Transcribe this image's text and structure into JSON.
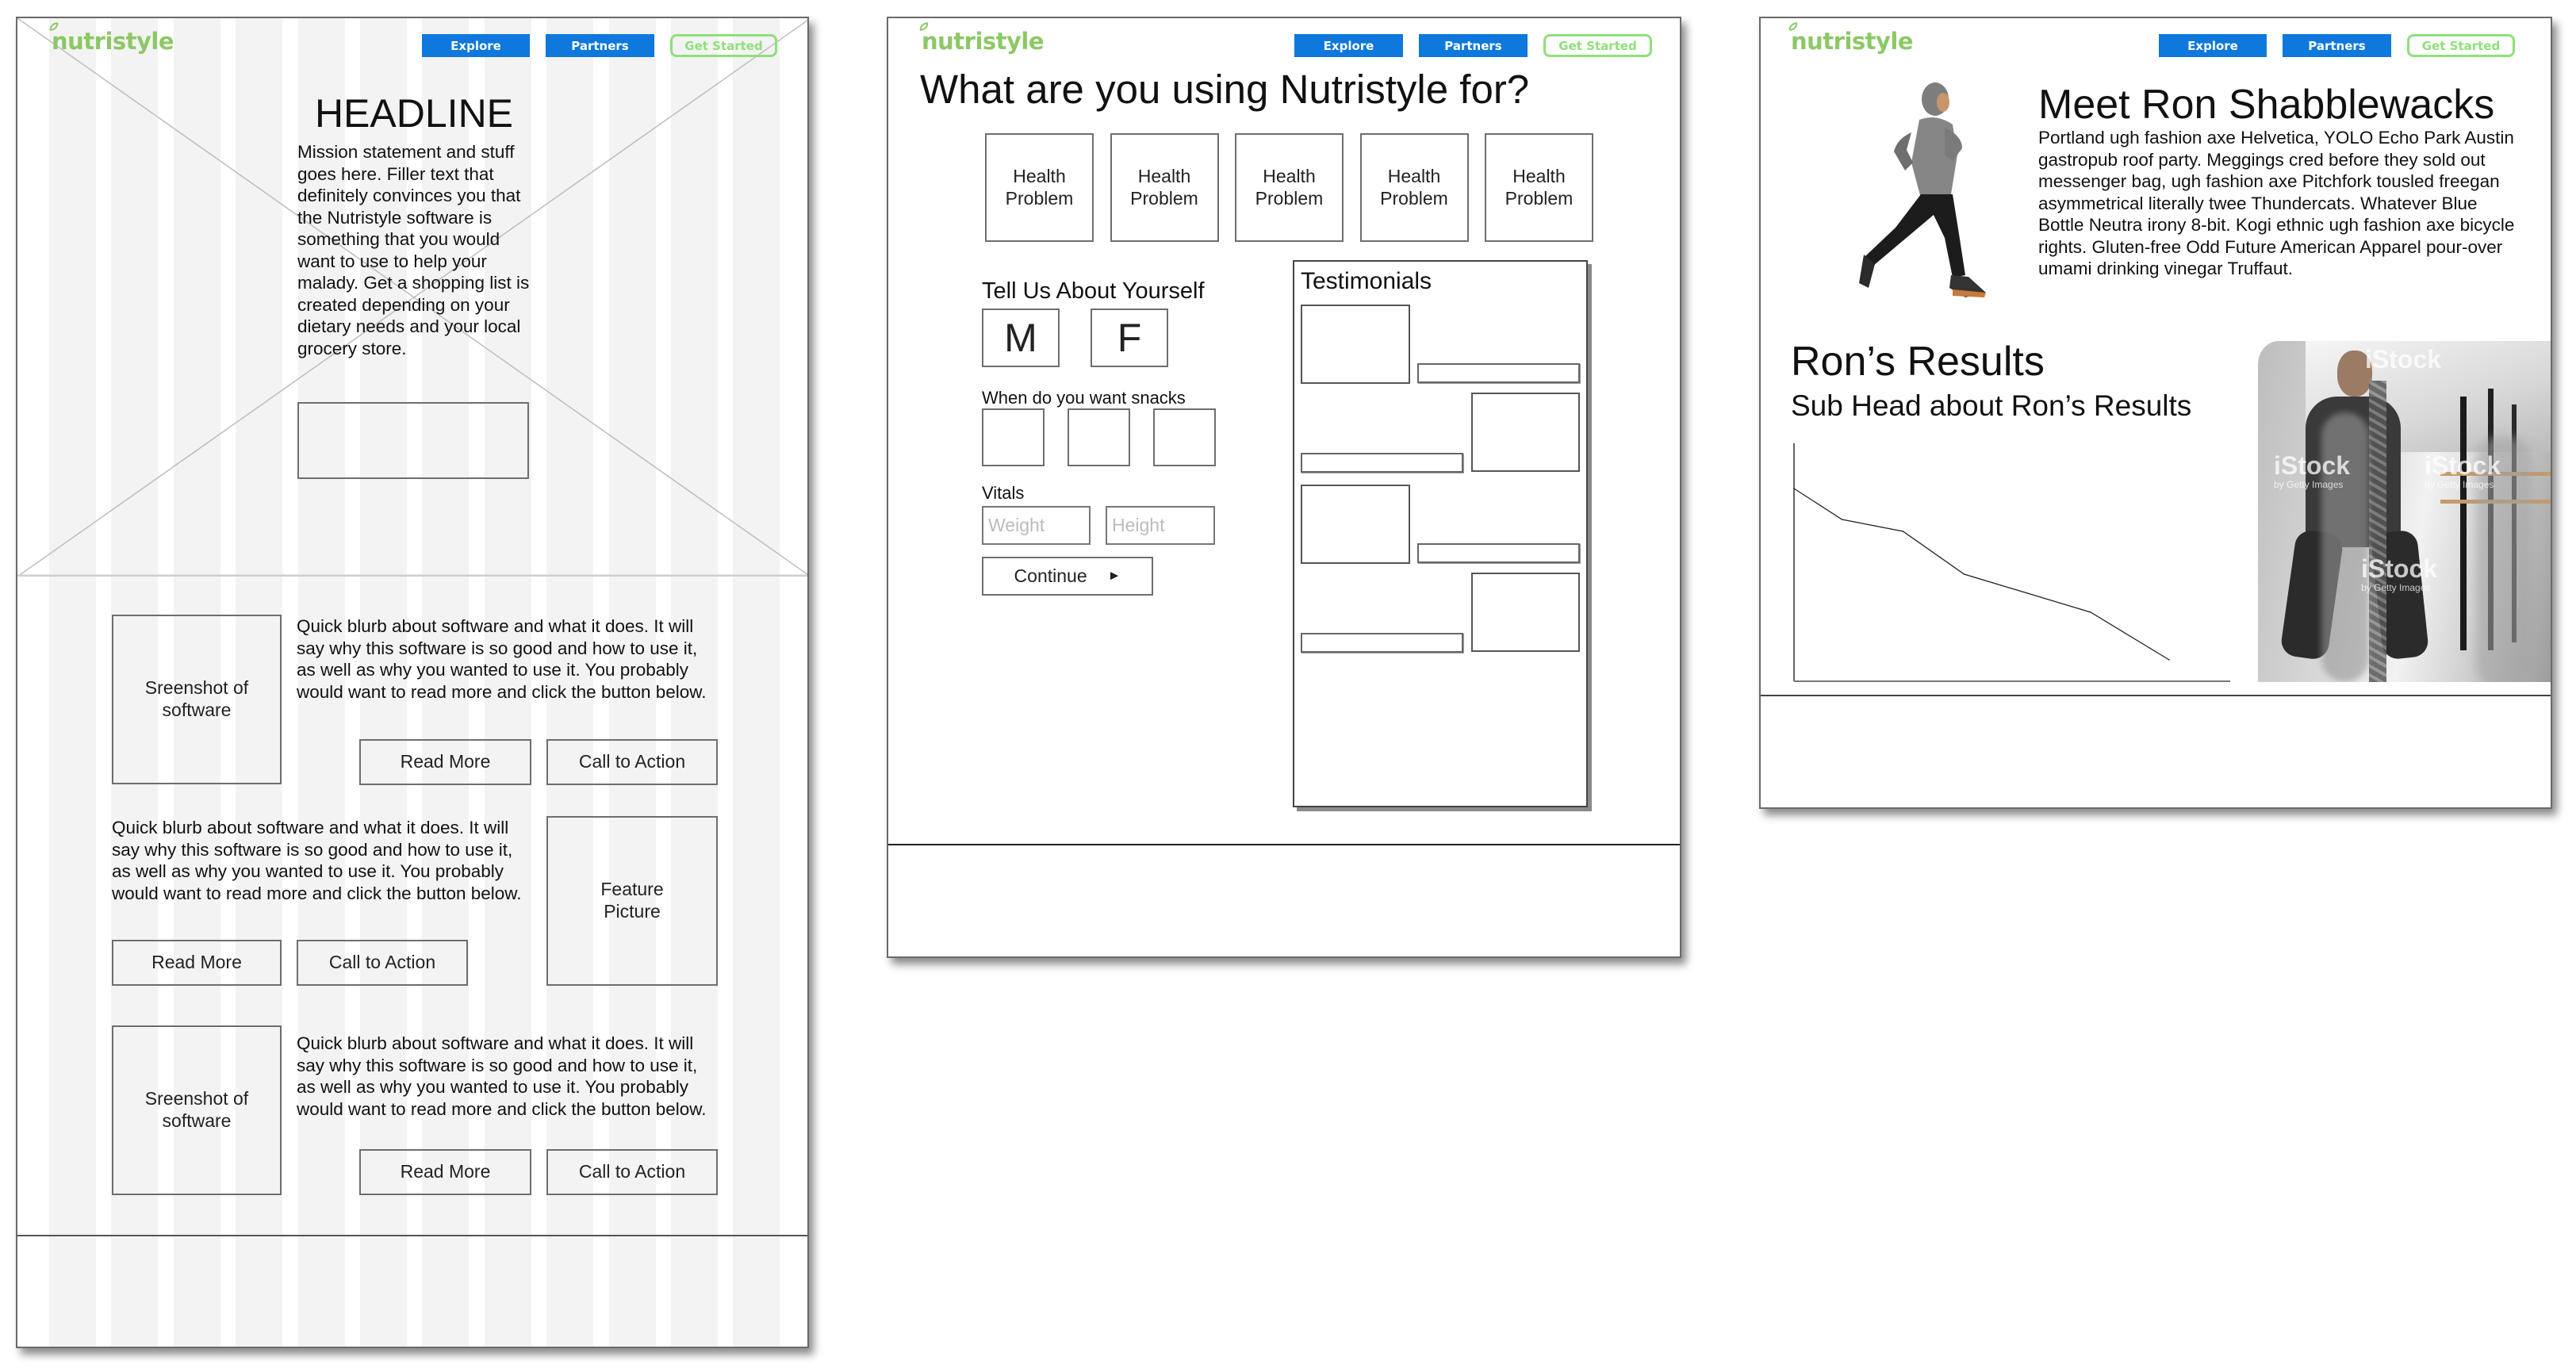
{
  "canvas": {
    "background": "#ffffff"
  },
  "brand": {
    "logo_text": "nutristyle",
    "logo_color": "#8cc866",
    "nav_blue": "#0e78dc",
    "nav_green": "#8ee07a"
  },
  "nav": {
    "explore": "Explore",
    "partners": "Partners",
    "get_started": "Get Started"
  },
  "home": {
    "headline": "HEADLINE",
    "mission": "Mission statement and stuff goes here. Filler text that definitely convinces you that the Nutristyle software is something that you would want to use to help your malady. Get a shopping list is created depending on your dietary needs and your local grocery store.",
    "sections": [
      {
        "image_label": "Sreenshot of software",
        "blurb": "Quick blurb about software and what it does. It will say why this software is so good and how to use it, as well as why you wanted to use it. You probably would want to read more and click the button below.",
        "read_more": "Read More",
        "cta": "Call to Action"
      },
      {
        "image_label": "Feature Picture",
        "blurb": "Quick blurb about software and what it does. It will say why this software is so good and how to use it, as well as why you wanted to use it. You probably would want to read more and click the button below.",
        "read_more": "Read More",
        "cta": "Call to Action"
      },
      {
        "image_label": "Sreenshot of software",
        "blurb": "Quick blurb about software and what it does. It will say why this software is so good and how to use it, as well as why you wanted to use it. You probably would want to read more and click the button below.",
        "read_more": "Read More",
        "cta": "Call to Action"
      }
    ]
  },
  "get_started": {
    "heading": "What are you using Nutristyle for?",
    "health_options": [
      "Health Problem",
      "Health Problem",
      "Health Problem",
      "Health Problem",
      "Health Problem"
    ],
    "tell_us": "Tell Us About Yourself",
    "gender_options": [
      "M",
      "F"
    ],
    "snacks_label": "When do you want snacks",
    "vitals_label": "Vitals",
    "weight_placeholder": "Weight",
    "height_placeholder": "Height",
    "weight_value": "",
    "height_value": "",
    "continue_label": "Continue",
    "continue_icon": "play-arrow-icon",
    "continue_glyph": "►",
    "testimonials_title": "Testimonials"
  },
  "testimonial": {
    "title": "Meet Ron Shabblewacks",
    "bio": "Portland ugh fashion axe Helvetica, YOLO Echo Park Austin gastropub roof party. Meggings cred before they sold out messenger bag, ugh fashion axe Pitchfork tousled freegan asymmetrical literally twee Thundercats. Whatever Blue Bottle Neutra irony 8-bit. Kogi ethnic ugh fashion axe bicycle rights. Gluten-free Odd Future American Apparel pour-over umami drinking vinegar Truffaut.",
    "results_title": "Ron’s Results",
    "results_subhead": "Sub Head about Ron’s Results",
    "runner_image": "runner-photo",
    "gym_image": "battle-rope-gym-photo",
    "watermark": "iStock",
    "watermark_sub": "by Getty Images"
  },
  "chart_data": {
    "type": "line",
    "title": "",
    "xlabel": "",
    "ylabel": "",
    "x": [
      0,
      11,
      25,
      39,
      68,
      86
    ],
    "values": [
      81,
      68,
      63,
      45,
      29,
      9
    ],
    "xlim": [
      0,
      100
    ],
    "ylim": [
      0,
      100
    ],
    "grid": false,
    "legend": "none"
  }
}
